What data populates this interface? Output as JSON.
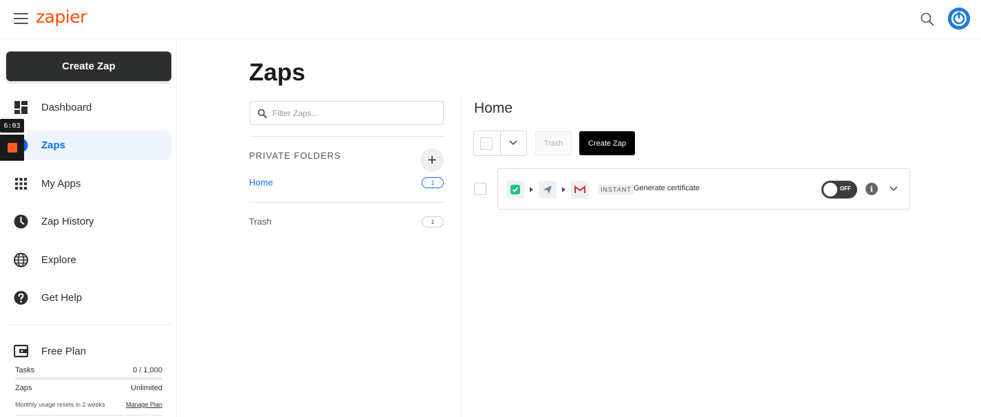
{
  "header": {
    "logo_text": "zapier",
    "brand_color": "#ff4f00",
    "accent_color": "#136bf5"
  },
  "sidebar": {
    "create_label": "Create Zap",
    "items": [
      {
        "label": "Dashboard",
        "icon": "dashboard-icon",
        "active": false
      },
      {
        "label": "Zaps",
        "icon": "zap-icon",
        "active": true
      },
      {
        "label": "My Apps",
        "icon": "grid-icon",
        "active": false
      },
      {
        "label": "Zap History",
        "icon": "clock-icon",
        "active": false
      },
      {
        "label": "Explore",
        "icon": "globe-icon",
        "active": false
      },
      {
        "label": "Get Help",
        "icon": "help-icon",
        "active": false
      }
    ],
    "plan": {
      "title": "Free Plan",
      "tasks_label": "Tasks",
      "tasks_value": "0 / 1,000",
      "tasks_fraction": 0,
      "zaps_label": "Zaps",
      "zaps_value": "Unlimited",
      "reset_text": "Monthly usage resets in 2 weeks",
      "manage_label": "Manage Plan"
    }
  },
  "recorder": {
    "time": "6:03"
  },
  "main": {
    "title": "Zaps",
    "filter_placeholder": "Filter Zaps...",
    "folders_heading": "PRIVATE FOLDERS",
    "folders": [
      {
        "name": "Home",
        "count": "1",
        "active": true
      },
      {
        "name": "Trash",
        "count": "1",
        "active": false
      }
    ]
  },
  "folder_view": {
    "title": "Home",
    "trash_label": "Trash",
    "create_label": "Create Zap",
    "zaps": [
      {
        "badge": "INSTANT",
        "name": "Generate certificate",
        "status": "OFF",
        "apps": [
          "webhook-app-icon",
          "send-app-icon",
          "gmail-app-icon"
        ]
      }
    ]
  }
}
